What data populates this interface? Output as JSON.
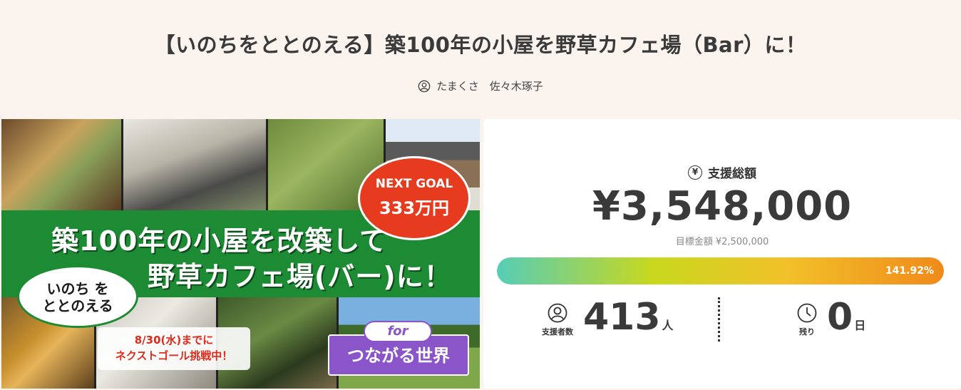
{
  "project": {
    "title": "【いのちをととのえる】築100年の小屋を野草カフェ場（Bar）に！",
    "owner_name": "たまくさ　佐々木琢子",
    "owner_icon": "user-icon"
  },
  "hero": {
    "band_line1": "築100年の小屋を改築して",
    "band_line2": "野草カフェ場(バー)に！",
    "goal_line1": "NEXT GOAL",
    "goal_line2": "333万円",
    "bubble_line1": "いのち を",
    "bubble_line2": "ととのえる",
    "deadline_line1": "8/30(水)までに",
    "deadline_line2": "ネクストゴール挑戦中！",
    "for_tag": "for",
    "tag_main": "つながる世界",
    "accent_green": "#1d8a34",
    "accent_red": "#e63b1f",
    "accent_purple": "#8a55c8"
  },
  "stats": {
    "total_label": "支援総額",
    "total_icon": "yen-icon",
    "total_amount": "¥3,548,000",
    "target_text": "目標金額 ¥2,500,000",
    "progress_percent": 141.92,
    "progress_label": "141.92%",
    "supporters_label": "支援者数",
    "supporters_icon": "person-icon",
    "supporters_count": "413",
    "supporters_unit": "人",
    "remaining_label": "残り",
    "remaining_icon": "clock-icon",
    "remaining_count": "0",
    "remaining_unit": "日"
  }
}
